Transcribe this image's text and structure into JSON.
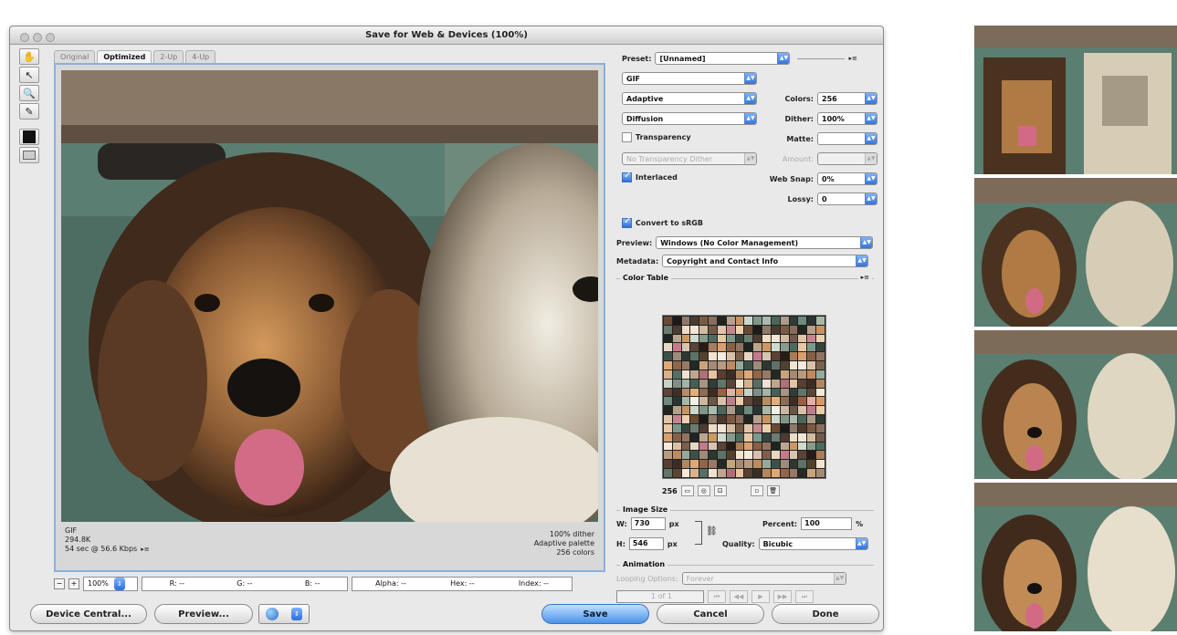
{
  "window": {
    "title": "Save for Web & Devices (100%)"
  },
  "tools": [
    "hand-icon",
    "slice-select-icon",
    "zoom-icon",
    "eyedropper-icon",
    "eyedropper-color-swatch",
    "toggle-slices-icon"
  ],
  "view_tabs": [
    "Original",
    "Optimized",
    "2-Up",
    "4-Up"
  ],
  "image_info": {
    "format": "GIF",
    "size": "294.8K",
    "download_time": "54 sec @ 56.6 Kbps",
    "menu_glyph": "▸≡",
    "dither": "100% dither",
    "palette": "Adaptive palette",
    "colors": "256 colors"
  },
  "status_bar": {
    "zoom": "100%",
    "r": "R: --",
    "g": "G: --",
    "b": "B: --",
    "alpha": "Alpha: --",
    "hex": "Hex: --",
    "index": "Index: --"
  },
  "settings": {
    "preset_label": "Preset:",
    "preset_value": "[Unnamed]",
    "format": "GIF",
    "reduction": "Adaptive",
    "dither_algorithm": "Diffusion",
    "colors_label": "Colors:",
    "colors_value": "256",
    "dither_label": "Dither:",
    "dither_value": "100%",
    "transparency_label": "Transparency",
    "transparency_checked": false,
    "matte_label": "Matte:",
    "matte_value": "",
    "transparency_dither": "No Transparency Dither",
    "amount_label": "Amount:",
    "interlaced_label": "Interlaced",
    "interlaced_checked": true,
    "web_snap_label": "Web Snap:",
    "web_snap_value": "0%",
    "lossy_label": "Lossy:",
    "lossy_value": "0",
    "convert_srgb_label": "Convert to sRGB",
    "convert_srgb_checked": true,
    "preview_label": "Preview:",
    "preview_value": "Windows (No Color Management)",
    "metadata_label": "Metadata:",
    "metadata_value": "Copyright and Contact Info"
  },
  "color_table": {
    "title": "Color Table",
    "count": "256",
    "swatches": [
      "#6b4a33",
      "#c9a47b",
      "#2f3b35",
      "#e7d7c1",
      "#8c6c52",
      "#4b6b5e",
      "#d9b28a",
      "#1c1a18",
      "#a58a74",
      "#6e8a7d",
      "#c47a8a",
      "#3d2c22",
      "#e9c9a4",
      "#586e63",
      "#8f7a6a",
      "#b89a80",
      "#2a3430",
      "#d7c4b0",
      "#9c5f3f",
      "#7b9a8c",
      "#f0e2d0",
      "#4a3a2e",
      "#c08a5c",
      "#a8b8a6",
      "#5a4234",
      "#e3b0a6",
      "#33443c",
      "#bfa58e",
      "#7a5a44",
      "#94aa9c",
      "#f6efe4",
      "#261c16",
      "#d49a6a",
      "#6a7c70",
      "#b06f7a",
      "#8a6d5a",
      "#3e5148",
      "#cdb79e",
      "#aa7d5a",
      "#c6d2c4",
      "#4d3b30",
      "#e6c2a0",
      "#20261f",
      "#9d8b7b",
      "#6b5544",
      "#d8a070",
      "#7d9084",
      "#eeddc6",
      "#583f30",
      "#b5a08a",
      "#2b3832",
      "#dcbfa4",
      "#895f44",
      "#a1b4a7",
      "#f2e6d6",
      "#3b2d24",
      "#c9935f",
      "#5e7166",
      "#bd7f8c",
      "#917460",
      "#456055",
      "#d3bba2",
      "#b48660",
      "#cbd7cb",
      "#54402f",
      "#eacca8",
      "#1e2420",
      "#a89482",
      "#735a48",
      "#dfa876",
      "#829687",
      "#f3e4cf",
      "#5f4535",
      "#bca68f",
      "#303d37",
      "#e0c5a9",
      "#936548",
      "#a9bbae",
      "#f5ebdc",
      "#402f25",
      "#cf9863",
      "#627569",
      "#c5868f",
      "#977a65",
      "#4b665b",
      "#d9c1a8",
      "#ba8c65",
      "#d0dbcf",
      "#5b4634",
      "#edd0ad",
      "#232924",
      "#ae9a88",
      "#7a604d",
      "#e4ad7b",
      "#889b8c",
      "#f6e8d4"
    ],
    "toolbar": [
      "wand-icon",
      "web-shift-icon",
      "lock-icon",
      "new-color-icon",
      "trash-icon"
    ]
  },
  "image_size": {
    "title": "Image Size",
    "w_label": "W:",
    "w_value": "730",
    "h_label": "H:",
    "h_value": "546",
    "unit": "px",
    "percent_label": "Percent:",
    "percent_value": "100",
    "percent_unit": "%",
    "quality_label": "Quality:",
    "quality_value": "Bicubic"
  },
  "animation": {
    "title": "Animation",
    "looping_label": "Looping Options:",
    "looping_value": "Forever",
    "frame": "1 of 1"
  },
  "buttons": {
    "device_central": "Device Central...",
    "preview": "Preview...",
    "save": "Save",
    "cancel": "Cancel",
    "done": "Done"
  },
  "thumbnails_count": 4
}
